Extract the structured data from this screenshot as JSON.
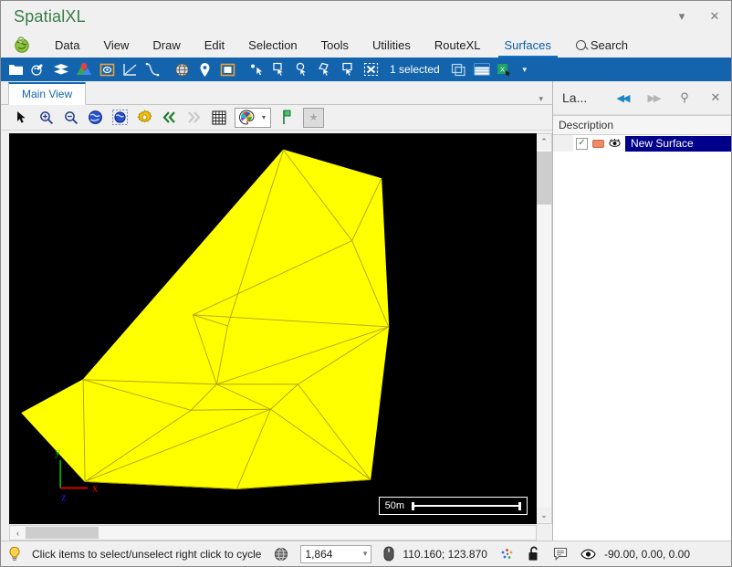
{
  "window": {
    "title": "SpatialXL",
    "title_color": "#3a7d44",
    "buttons": [
      {
        "name": "titlebar-dropdown",
        "glyph": "▾"
      },
      {
        "name": "titlebar-close",
        "glyph": "✕"
      }
    ]
  },
  "menubar": {
    "logo_icon": "globe-logo-icon",
    "items": [
      {
        "label": "Data",
        "active": false
      },
      {
        "label": "View",
        "active": false
      },
      {
        "label": "Draw",
        "active": false
      },
      {
        "label": "Edit",
        "active": false
      },
      {
        "label": "Selection",
        "active": false
      },
      {
        "label": "Tools",
        "active": false
      },
      {
        "label": "Utilities",
        "active": false
      },
      {
        "label": "RouteXL",
        "active": false
      },
      {
        "label": "Surfaces",
        "active": true
      }
    ],
    "search_label": "Search",
    "search_icon": "search-icon",
    "active_color": "#0b6fc4"
  },
  "ribbon": {
    "background": "#1464ad",
    "selection_label": "1 selected",
    "tools": [
      {
        "name": "open-folder-icon"
      },
      {
        "name": "palette-tool-icon"
      },
      {
        "name": "layers-stack-icon"
      },
      {
        "name": "map-pin-icon"
      },
      {
        "name": "target-frame-icon"
      },
      {
        "name": "measure-angle-icon"
      },
      {
        "name": "curve-xy-icon"
      },
      {
        "name": "globe-icon"
      },
      {
        "name": "location-pin-icon"
      },
      {
        "name": "image-frame-icon"
      },
      {
        "name": "point-select-icon"
      },
      {
        "name": "select-rectangle-icon"
      },
      {
        "name": "select-circle-icon"
      },
      {
        "name": "select-polygon-icon"
      },
      {
        "name": "select-box-icon"
      },
      {
        "name": "clear-selection-icon"
      }
    ],
    "right_tools": [
      {
        "name": "copy-selection-icon"
      },
      {
        "name": "table-view-icon"
      },
      {
        "name": "excel-export-icon"
      }
    ],
    "overflow_glyph": "▾"
  },
  "document": {
    "tab_label": "Main View",
    "tab_overflow_glyph": "▾",
    "view_tools": [
      {
        "name": "pointer-arrow-icon"
      },
      {
        "name": "zoom-in-icon"
      },
      {
        "name": "zoom-out-icon"
      },
      {
        "name": "globe-zoom-extent-icon"
      },
      {
        "name": "globe-zoom-selection-icon"
      },
      {
        "name": "settings-gear-icon"
      },
      {
        "name": "previous-view-icon"
      },
      {
        "name": "next-view-icon"
      },
      {
        "name": "grid-icon"
      }
    ],
    "palette_icon": "color-palette-icon",
    "palette_caret": "▾",
    "bookmark_icon": "green-flag-icon",
    "star_icon": "star-icon"
  },
  "canvas": {
    "background": "#000000",
    "surface_fill": "#ffff00",
    "surface_edge": "#b8a800",
    "scalebar_label": "50m",
    "axis": {
      "x_label": "x",
      "x_color": "#ff0000",
      "y_label": "y",
      "y_color": "#00c000",
      "z_label": "z",
      "z_color": "#0000ff"
    },
    "scrollbars": {
      "up_glyph": "⌃",
      "down_glyph": "⌄",
      "left_glyph": "‹",
      "right_glyph": "›"
    }
  },
  "layers_panel": {
    "title": "La...",
    "column_header": "Description",
    "buttons": [
      {
        "name": "collapse-left-button",
        "glyph": "◀◀",
        "accent": true
      },
      {
        "name": "expand-right-button",
        "glyph": "▶▶",
        "accent": false
      },
      {
        "name": "pin-button",
        "glyph": "⚲",
        "accent": false
      },
      {
        "name": "close-panel-button",
        "glyph": "✕",
        "accent": false
      }
    ],
    "rows": [
      {
        "name": "New Surface",
        "checked": true,
        "check_glyph": "✓",
        "swatch_color": "#ef8a66",
        "visibility_icon": "visibility-eye-icon",
        "selected": true
      }
    ]
  },
  "statusbar": {
    "hint_icon": "lightbulb-icon",
    "message": "Click items to select/unselect right click to cycle",
    "globe_icon": "globe-small-icon",
    "scale_value": "1,864",
    "scale_caret": "▾",
    "mouse_icon": "mouse-icon",
    "coordinates": "110.160; 123.870",
    "points_icon": "scatter-points-icon",
    "lock_icon": "unlocked-padlock-icon",
    "note_icon": "note-balloon-icon",
    "eye_icon": "eye-icon",
    "rotation": "-90.00, 0.00, 0.00"
  }
}
